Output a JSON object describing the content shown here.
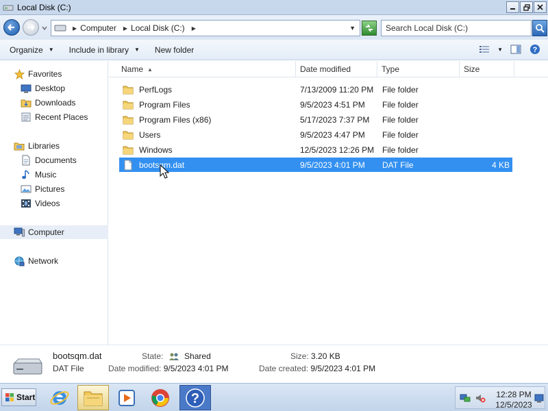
{
  "window": {
    "title": "Local Disk (C:)"
  },
  "address": {
    "breadcrumbs": [
      "Computer",
      "Local Disk (C:)"
    ],
    "search_placeholder": "Search Local Disk (C:)"
  },
  "toolbar": {
    "organize": "Organize",
    "include_in_library": "Include in library",
    "new_folder": "New folder"
  },
  "nav": {
    "favorites": {
      "label": "Favorites",
      "items": [
        "Desktop",
        "Downloads",
        "Recent Places"
      ]
    },
    "libraries": {
      "label": "Libraries",
      "items": [
        "Documents",
        "Music",
        "Pictures",
        "Videos"
      ]
    },
    "computer": "Computer",
    "network": "Network"
  },
  "columns": [
    "Name",
    "Date modified",
    "Type",
    "Size"
  ],
  "files": [
    {
      "name": "PerfLogs",
      "date": "7/13/2009 11:20 PM",
      "type": "File folder",
      "size": "",
      "icon": "folder-icon"
    },
    {
      "name": "Program Files",
      "date": "9/5/2023 4:51 PM",
      "type": "File folder",
      "size": "",
      "icon": "folder-icon"
    },
    {
      "name": "Program Files (x86)",
      "date": "5/17/2023 7:37 PM",
      "type": "File folder",
      "size": "",
      "icon": "folder-icon"
    },
    {
      "name": "Users",
      "date": "9/5/2023 4:47 PM",
      "type": "File folder",
      "size": "",
      "icon": "folder-icon"
    },
    {
      "name": "Windows",
      "date": "12/5/2023 12:26 PM",
      "type": "File folder",
      "size": "",
      "icon": "folder-icon"
    },
    {
      "name": "bootsqm.dat",
      "date": "9/5/2023 4:01 PM",
      "type": "DAT File",
      "size": "4 KB",
      "icon": "file-icon",
      "selected": true
    }
  ],
  "details": {
    "name": "bootsqm.dat",
    "type": "DAT File",
    "state_label": "State:",
    "state_value": "Shared",
    "size_label": "Size:",
    "size_value": "3.20 KB",
    "modified_label": "Date modified:",
    "modified_value": "9/5/2023 4:01 PM",
    "created_label": "Date created:",
    "created_value": "9/5/2023 4:01 PM"
  },
  "taskbar": {
    "start": "Start",
    "time": "12:28 PM",
    "date": "12/5/2023"
  }
}
